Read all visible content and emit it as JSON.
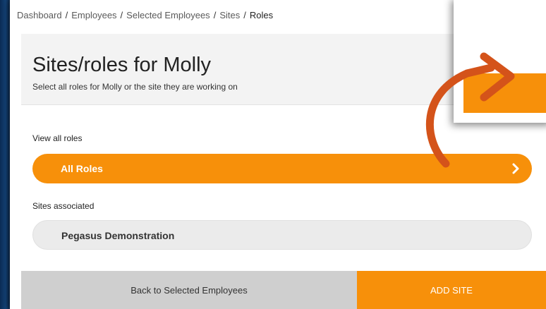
{
  "breadcrumb": {
    "items": [
      "Dashboard",
      "Employees",
      "Selected Employees",
      "Sites"
    ],
    "separator": "/",
    "current": "Roles"
  },
  "header": {
    "title": "Sites/roles for Molly",
    "subtitle": "Select all roles for Molly or the site they are working on"
  },
  "view_roles": {
    "label": "View all roles",
    "button_label": "All Roles"
  },
  "sites": {
    "label": "Sites associated",
    "items": [
      {
        "name": "Pegasus Demonstration"
      }
    ]
  },
  "footer": {
    "back_label": "Back to Selected Employees",
    "add_label": "ADD SITE"
  },
  "colors": {
    "accent": "#f7900a",
    "annotation_arrow": "#d4531a",
    "footer_grey": "#cfcfcf",
    "pill_grey": "#ebebeb"
  },
  "icons": {
    "chevron": "chevron-right-icon",
    "annotation": "curved-arrow-icon"
  }
}
